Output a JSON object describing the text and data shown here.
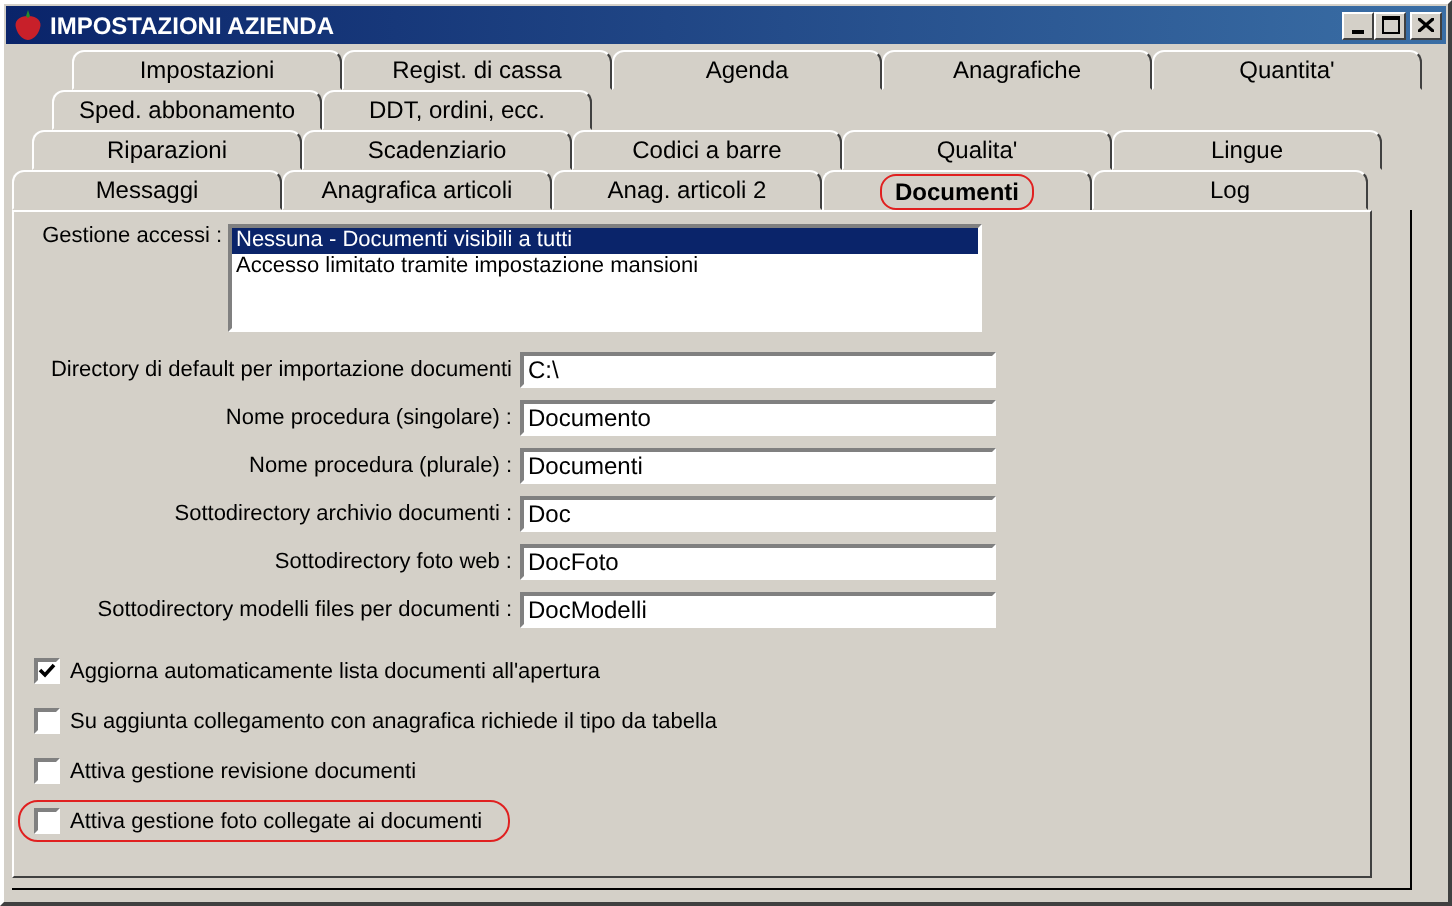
{
  "window": {
    "title": "IMPOSTAZIONI AZIENDA"
  },
  "tab_rows": [
    [
      {
        "label": "Impostazioni",
        "selected": false,
        "highlighted": false
      },
      {
        "label": "Regist. di cassa",
        "selected": false,
        "highlighted": false
      },
      {
        "label": "Agenda",
        "selected": false,
        "highlighted": false
      },
      {
        "label": "Anagrafiche",
        "selected": false,
        "highlighted": false
      },
      {
        "label": "Quantita'",
        "selected": false,
        "highlighted": false
      }
    ],
    [
      {
        "label": "Sped. abbonamento",
        "selected": false,
        "highlighted": false
      },
      {
        "label": "DDT, ordini, ecc.",
        "selected": false,
        "highlighted": false
      }
    ],
    [
      {
        "label": "Riparazioni",
        "selected": false,
        "highlighted": false
      },
      {
        "label": "Scadenziario",
        "selected": false,
        "highlighted": false
      },
      {
        "label": "Codici a barre",
        "selected": false,
        "highlighted": false
      },
      {
        "label": "Qualita'",
        "selected": false,
        "highlighted": false
      },
      {
        "label": "Lingue",
        "selected": false,
        "highlighted": false
      }
    ],
    [
      {
        "label": "Messaggi",
        "selected": false,
        "highlighted": false
      },
      {
        "label": "Anagrafica articoli",
        "selected": false,
        "highlighted": false
      },
      {
        "label": "Anag. articoli 2",
        "selected": false,
        "highlighted": false
      },
      {
        "label": "Documenti",
        "selected": true,
        "highlighted": true
      },
      {
        "label": "Log",
        "selected": false,
        "highlighted": false
      }
    ]
  ],
  "access": {
    "label": "Gestione accessi :",
    "options": [
      {
        "label": "Nessuna - Documenti visibili a tutti",
        "selected": true
      },
      {
        "label": "Accesso limitato tramite impostazione mansioni",
        "selected": false
      }
    ]
  },
  "fields": [
    {
      "label": "Directory di default per importazione documenti",
      "value": "C:\\"
    },
    {
      "label": "Nome procedura (singolare) :",
      "value": "Documento"
    },
    {
      "label": "Nome procedura (plurale) :",
      "value": "Documenti"
    },
    {
      "label": "Sottodirectory archivio documenti :",
      "value": "Doc"
    },
    {
      "label": "Sottodirectory foto web :",
      "value": "DocFoto"
    },
    {
      "label": "Sottodirectory modelli files per documenti :",
      "value": "DocModelli"
    }
  ],
  "checkboxes": [
    {
      "label": "Aggiorna automaticamente lista documenti all'apertura",
      "checked": true,
      "highlighted": false
    },
    {
      "label": "Su aggiunta collegamento con anagrafica richiede il tipo da tabella",
      "checked": false,
      "highlighted": false
    },
    {
      "label": "Attiva gestione revisione documenti",
      "checked": false,
      "highlighted": false
    },
    {
      "label": "Attiva gestione foto collegate ai documenti",
      "checked": false,
      "highlighted": true
    }
  ]
}
